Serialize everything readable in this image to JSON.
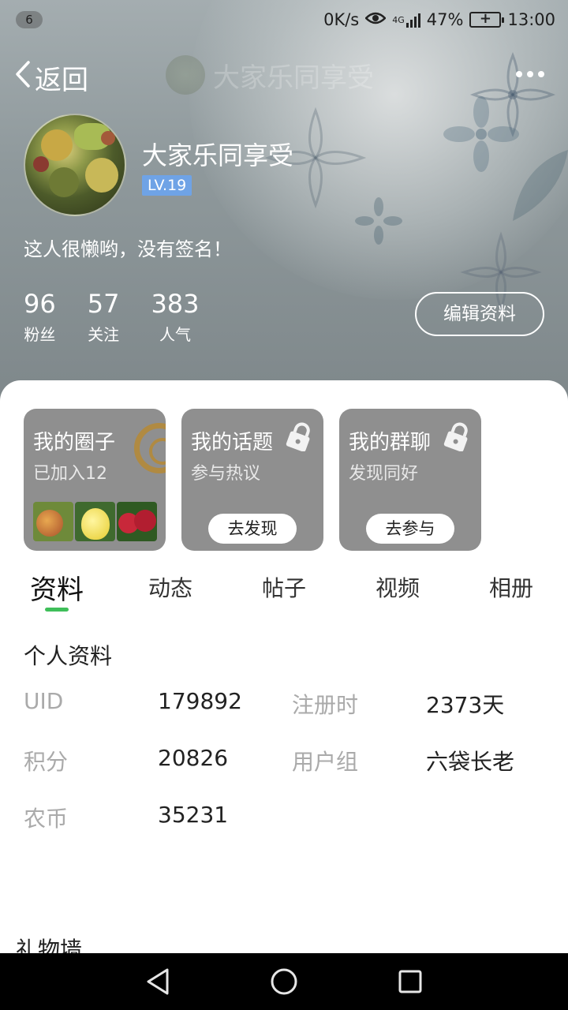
{
  "status_bar": {
    "notification_count": "6",
    "net_speed": "0K/s",
    "network_type": "4G",
    "battery": "47%",
    "time": "13:00"
  },
  "nav": {
    "back_label": "返回",
    "faded_title": "大家乐同享受"
  },
  "profile": {
    "username": "大家乐同享受",
    "level": "LV.19",
    "signature": "这人很懒哟，没有签名！",
    "stats": [
      {
        "value": "96",
        "label": "粉丝"
      },
      {
        "value": "57",
        "label": "关注"
      },
      {
        "value": "383",
        "label": "人气"
      }
    ],
    "edit_label": "编辑资料"
  },
  "cards": [
    {
      "title": "我的圈子",
      "subtitle": "已加入12"
    },
    {
      "title": "我的话题",
      "subtitle": "参与热议",
      "button": "去发现"
    },
    {
      "title": "我的群聊",
      "subtitle": "发现同好",
      "button": "去参与"
    }
  ],
  "tabs": [
    "资料",
    "动态",
    "帖子",
    "视频",
    "相册"
  ],
  "active_tab": "资料",
  "personal_info": {
    "title": "个人资料",
    "rows": [
      {
        "k1": "UID",
        "v1": "179892",
        "k2": "注册时",
        "v2": "2373天"
      },
      {
        "k1": "积分",
        "v1": "20826",
        "k2": "用户组",
        "v2": "六袋长老"
      },
      {
        "k1": "农币",
        "v1": "35231",
        "k2": "",
        "v2": ""
      }
    ]
  },
  "gift_wall_title": "礼物墙",
  "colors": {
    "accent_green": "#3fbf5a",
    "level_badge": "#6fa3e6",
    "card_gray": "#8f8f8f"
  }
}
